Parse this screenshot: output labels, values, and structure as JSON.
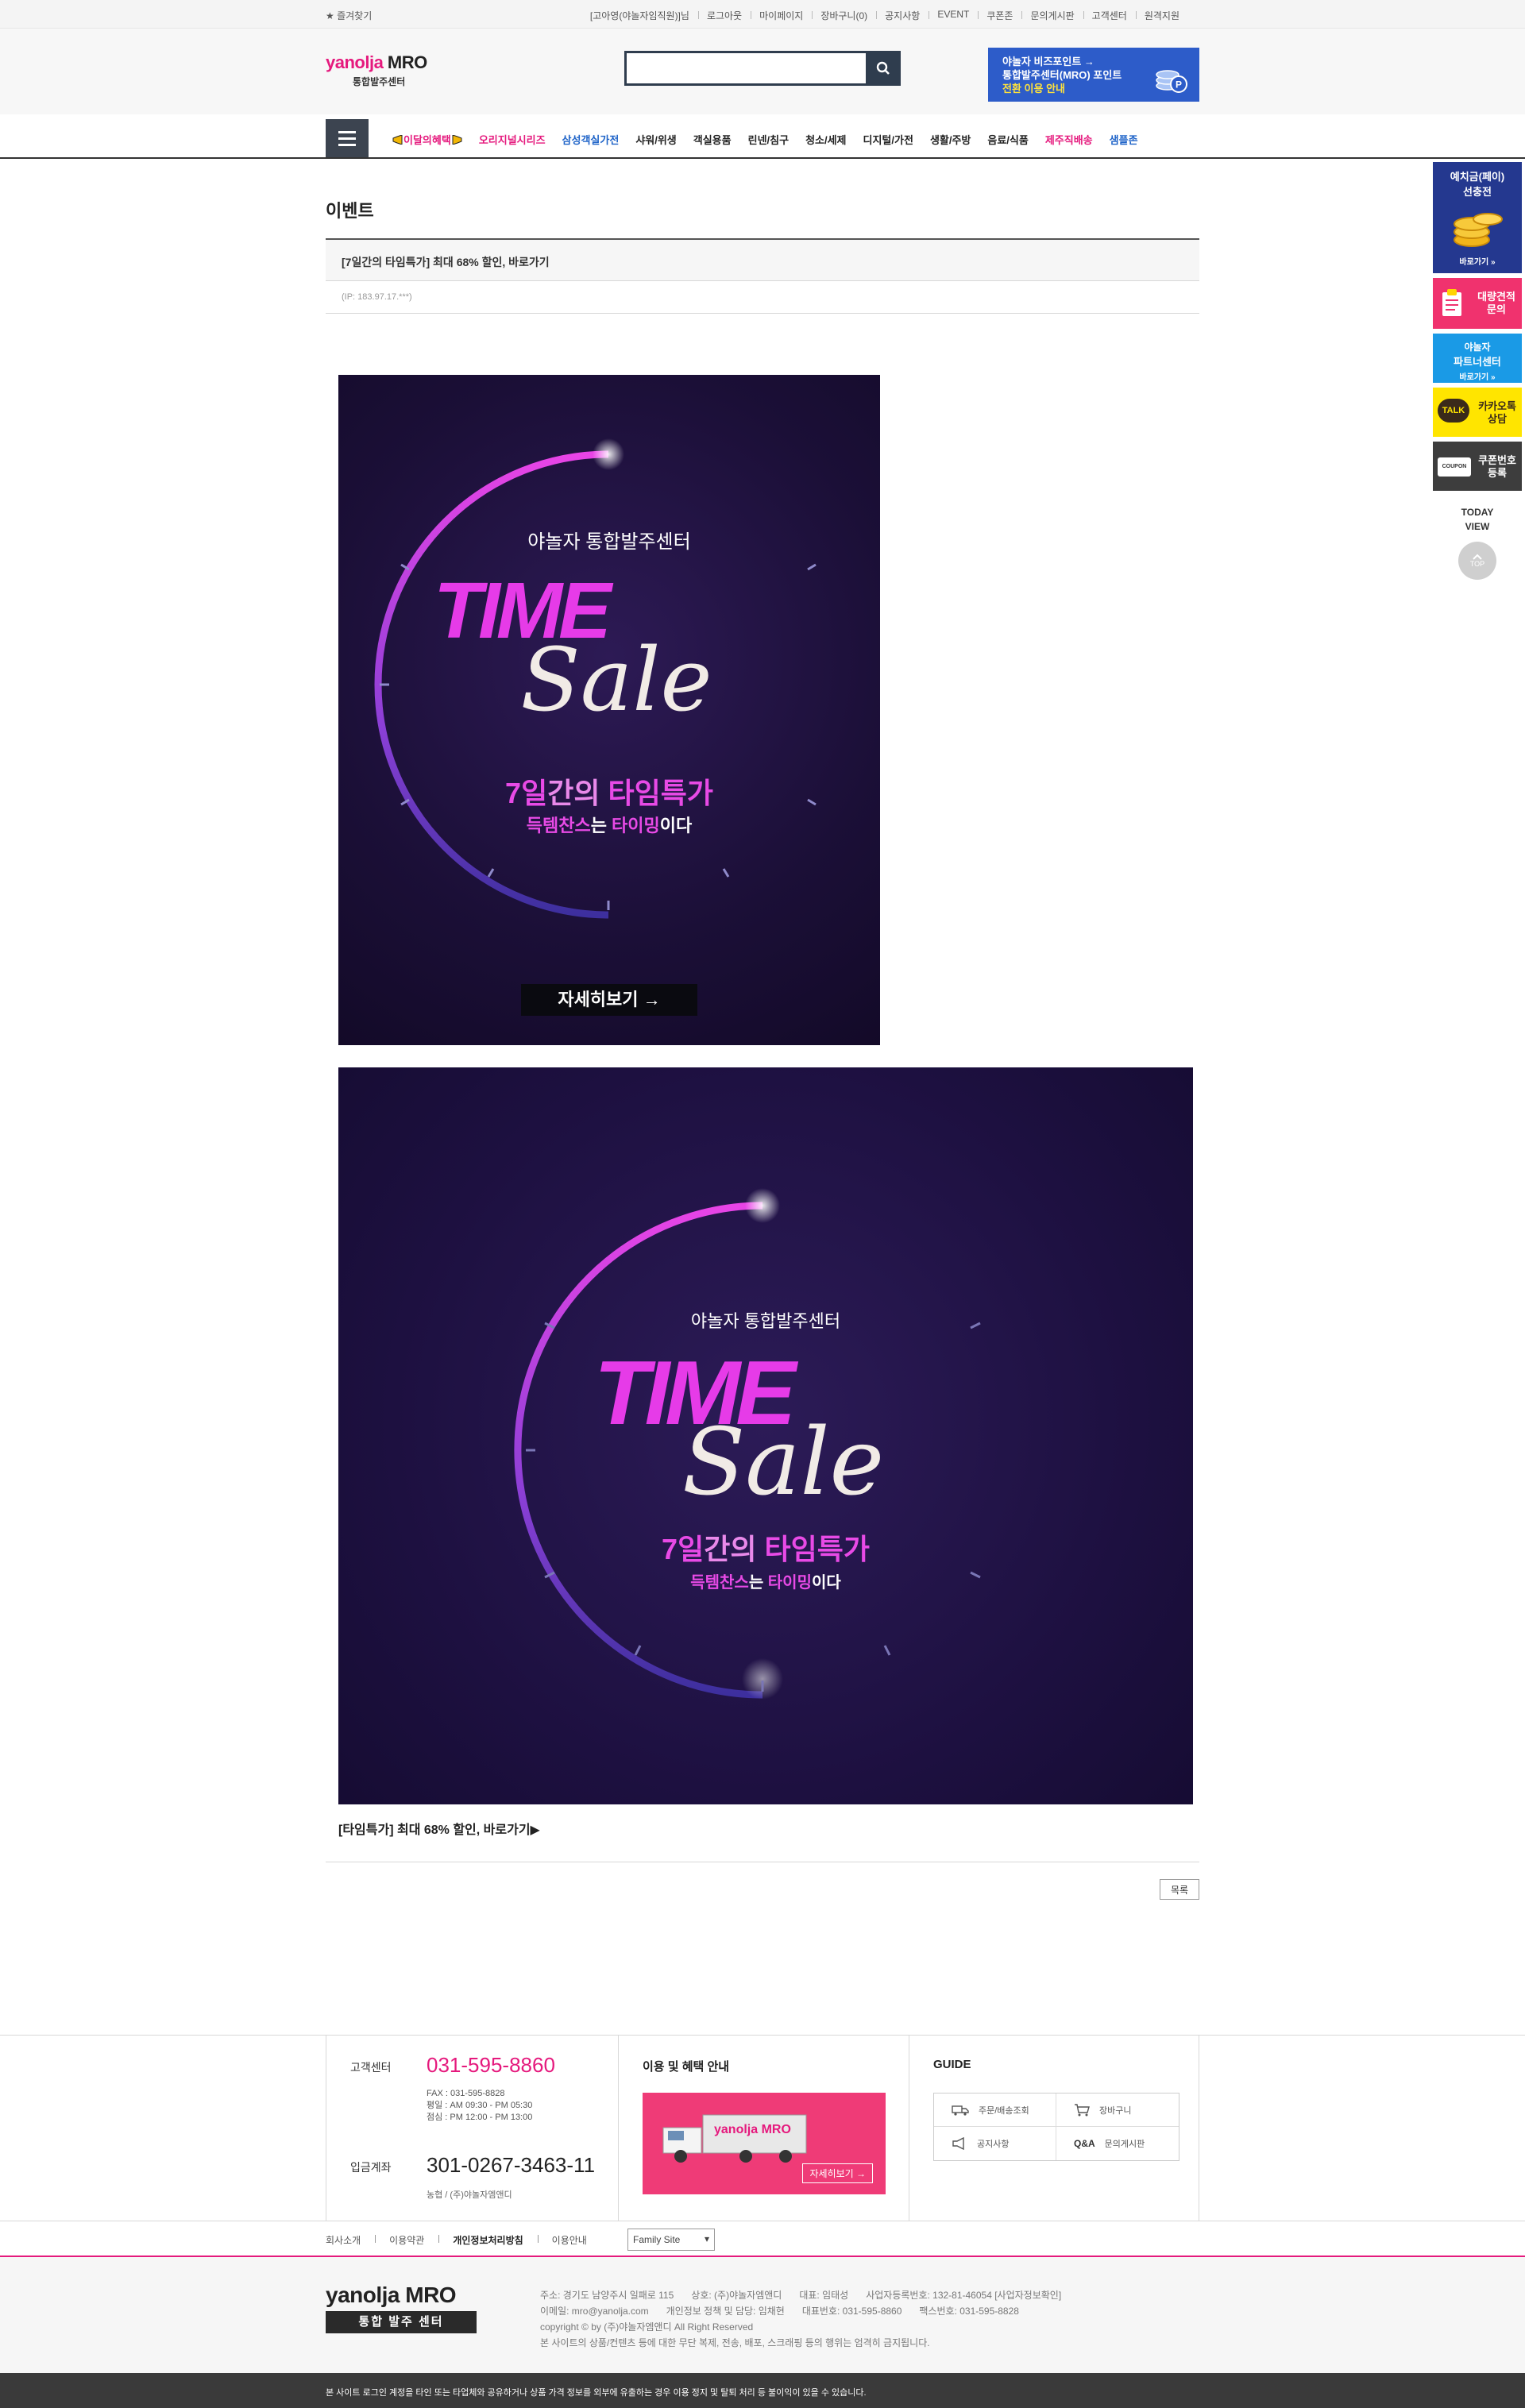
{
  "topbar": {
    "favorite": "★ 즐겨찾기",
    "user": "[고아영(야놀자임직원)]님",
    "items": [
      "로그아웃",
      "마이페이지",
      "장바구니(0)",
      "공지사항",
      "EVENT",
      "쿠폰존",
      "문의게시판",
      "고객센터",
      "원격지원"
    ]
  },
  "header": {
    "logo_main": "yanolja",
    "logo_mro": " MRO",
    "logo_sub": "통합발주센터",
    "search_placeholder": "",
    "promo_line1": "야놀자 비즈포인트 →",
    "promo_line2": "통합발주센터(MRO) 포인트",
    "promo_line3": "전환 이용 안내"
  },
  "gnb": {
    "categories": [
      "이달의혜택",
      "오리지널시리즈",
      "삼성객실가전",
      "샤워/위생",
      "객실용품",
      "린넨/침구",
      "청소/세제",
      "디지털/가전",
      "생활/주방",
      "음료/식품",
      "제주직배송",
      "샘플존"
    ]
  },
  "content": {
    "page_title": "이벤트",
    "subject": "[7일간의 타임특가] 최대 68% 할인, 바로가기",
    "ip": "(IP: 183.97.17.***)",
    "banner_header": "야놀자 통합발주센터",
    "banner_time": "TIME",
    "banner_sale": "Sale",
    "banner_line1_a": "7일",
    "banner_line1_b": "간의 ",
    "banner_line1_c": "타임특가",
    "banner_line2_a": "득템찬스",
    "banner_line2_b": "는 ",
    "banner_line2_c": "타이밍",
    "banner_line2_d": "이다",
    "banner_cta": "자세히보기 →",
    "caption": "[타임특가] 최대 68% 할인, 바로가기▶",
    "list_button": "목록"
  },
  "quick": {
    "q1_line1": "예치금(페이)",
    "q1_line2": "선충전",
    "q1_link": "바로가기 »",
    "q2_line1": "대량견적",
    "q2_line2": "문의",
    "q3_line1": "야놀자",
    "q3_line2": "파트너센터",
    "q3_link": "바로가기 »",
    "q4_badge": "TALK",
    "q4_line1": "카카오톡",
    "q4_line2": "상담",
    "q5_badge": "COUPON",
    "q5_line1": "쿠폰번호",
    "q5_line2": "등록",
    "today1": "TODAY",
    "today2": "VIEW",
    "top": "TOP"
  },
  "footer": {
    "cs_label": "고객센터",
    "cs_number": "031-595-8860",
    "cs_fax": "FAX  :  031-595-8828",
    "cs_weekday": "평일  :  AM 09:30 - PM 05:30",
    "cs_lunch": "점심  :  PM 12:00 - PM 13:00",
    "bank_label": "입금계좌",
    "bank_number": "301-0267-3463-11",
    "bank_sub": "농협 / (주)야놀자엠앤디",
    "benefit_title": "이용 및 혜택 안내",
    "truck_logo": "yanolja MRO",
    "benefit_more": "자세히보기 →",
    "guide_title": "GUIDE",
    "guide_items": [
      "주문/배송조회",
      "장바구니",
      "공지사항",
      "문의게시판"
    ],
    "guide_qa": "Q&A",
    "links": [
      "회사소개",
      "이용약관",
      "개인정보처리방침",
      "이용안내"
    ],
    "family_site": "Family Site",
    "flogo": "yanolja MRO",
    "flogo_sub": "통합 발주 센터",
    "addr": "주소: 경기도 남양주시 일패로 115",
    "company": "상호: (주)야놀자엠앤디",
    "ceo": "대표: 임태성",
    "biz": "사업자등록번호: 132-81-46054 [사업자정보확인]",
    "email": "이메일: mro@yanolja.com",
    "privacy": "개인정보 정책 및 담당: 임채현",
    "tel": "대표번호: 031-595-8860",
    "fax": "팩스번호: 031-595-8828",
    "copyright": "copyright © by (주)야놀자엠앤디 All Right Reserved",
    "notice": "본 사이트의 상품/컨텐츠 등에 대한 무단 복제, 전송, 배포, 스크래핑 등의 행위는 엄격히 금지됩니다.",
    "bottom": "본 사이트 로그인 계정을 타인 또는 타업체와 공유하거나 상품 가격 정보를 외부에 유출하는 경우 이용 정지 및 탈퇴 처리 등 불이익이 있을 수 있습니다."
  },
  "colors": {
    "brand_pink": "#e5197d",
    "brand_blue": "#2d5cc9",
    "banner_bg": "#1b0f37",
    "banner_magenta": "#e63be8"
  }
}
